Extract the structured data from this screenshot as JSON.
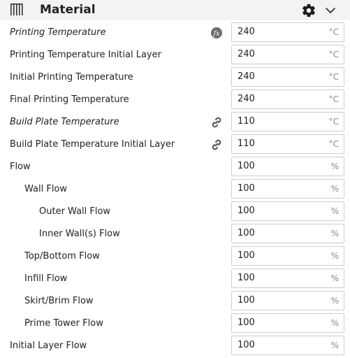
{
  "header": {
    "title": "Material",
    "category_icon": "material-spool-icon",
    "settings_icon": "gear-icon",
    "collapse_icon": "chevron-down-icon"
  },
  "settings": [
    {
      "id": "printing-temperature",
      "label": "Printing Temperature",
      "value": "240",
      "unit": "°C",
      "italic": true,
      "icon": "function-icon",
      "indent": 0
    },
    {
      "id": "printing-temperature-initial-layer",
      "label": "Printing Temperature Initial Layer",
      "value": "240",
      "unit": "°C",
      "italic": false,
      "icon": "",
      "indent": 0
    },
    {
      "id": "initial-printing-temperature",
      "label": "Initial Printing Temperature",
      "value": "240",
      "unit": "°C",
      "italic": false,
      "icon": "",
      "indent": 0
    },
    {
      "id": "final-printing-temperature",
      "label": "Final Printing Temperature",
      "value": "240",
      "unit": "°C",
      "italic": false,
      "icon": "",
      "indent": 0
    },
    {
      "id": "build-plate-temperature",
      "label": "Build Plate Temperature",
      "value": "110",
      "unit": "°C",
      "italic": true,
      "icon": "link-icon",
      "indent": 0
    },
    {
      "id": "build-plate-temperature-initial-layer",
      "label": "Build Plate Temperature Initial Layer",
      "value": "110",
      "unit": "°C",
      "italic": false,
      "icon": "link-icon",
      "indent": 0
    },
    {
      "id": "flow",
      "label": "Flow",
      "value": "100",
      "unit": "%",
      "italic": false,
      "icon": "",
      "indent": 0
    },
    {
      "id": "wall-flow",
      "label": "Wall Flow",
      "value": "100",
      "unit": "%",
      "italic": false,
      "icon": "",
      "indent": 1
    },
    {
      "id": "outer-wall-flow",
      "label": "Outer Wall Flow",
      "value": "100",
      "unit": "%",
      "italic": false,
      "icon": "",
      "indent": 2
    },
    {
      "id": "inner-wall-flow",
      "label": "Inner Wall(s) Flow",
      "value": "100",
      "unit": "%",
      "italic": false,
      "icon": "",
      "indent": 2
    },
    {
      "id": "top-bottom-flow",
      "label": "Top/Bottom Flow",
      "value": "100",
      "unit": "%",
      "italic": false,
      "icon": "",
      "indent": 1
    },
    {
      "id": "infill-flow",
      "label": "Infill Flow",
      "value": "100",
      "unit": "%",
      "italic": false,
      "icon": "",
      "indent": 1
    },
    {
      "id": "skirt-brim-flow",
      "label": "Skirt/Brim Flow",
      "value": "100",
      "unit": "%",
      "italic": false,
      "icon": "",
      "indent": 1
    },
    {
      "id": "prime-tower-flow",
      "label": "Prime Tower Flow",
      "value": "100",
      "unit": "%",
      "italic": false,
      "icon": "",
      "indent": 1
    },
    {
      "id": "initial-layer-flow",
      "label": "Initial Layer Flow",
      "value": "100",
      "unit": "%",
      "italic": false,
      "icon": "",
      "indent": 0
    }
  ],
  "colors": {
    "header_bg": "#f2f3f5",
    "text": "#222222",
    "unit": "#8a8a8a",
    "field_border": "#cdcdd3",
    "icon": "#555555",
    "gear": "#1e1e1e"
  }
}
